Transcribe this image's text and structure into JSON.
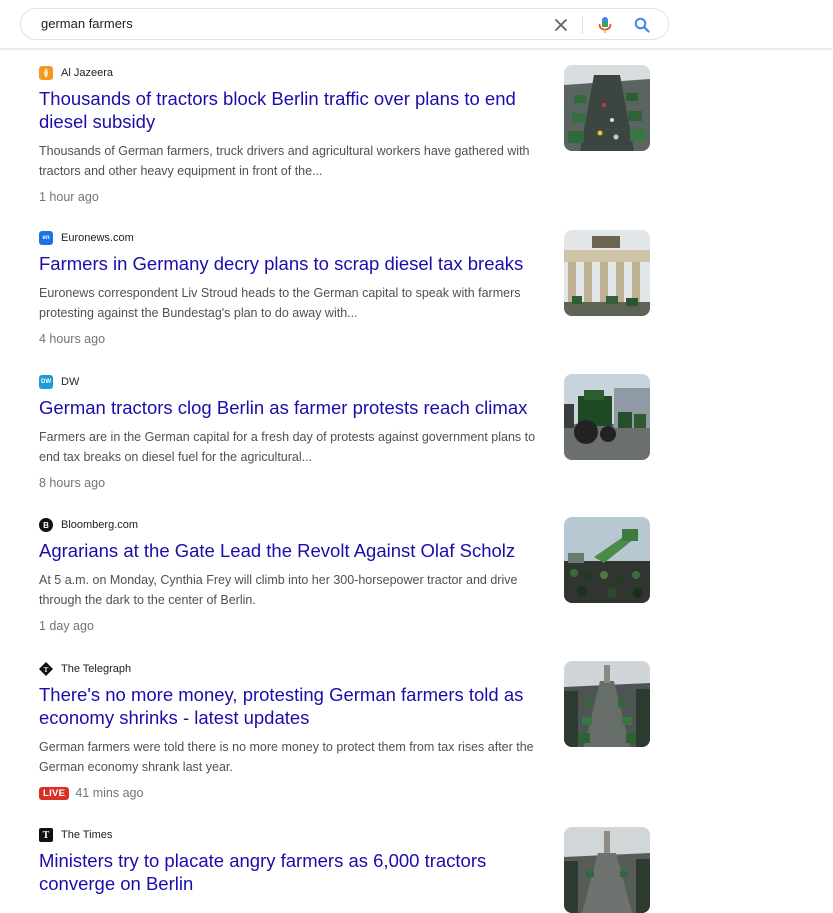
{
  "search": {
    "query": "german farmers"
  },
  "results": [
    {
      "source": "Al Jazeera",
      "favicon": {
        "bg": "#f29a1f",
        "glyph": "◊",
        "color": "#ffffff"
      },
      "title": "Thousands of tractors block Berlin traffic over plans to end diesel subsidy",
      "snippet": "Thousands of German farmers, truck drivers and agricultural workers have gathered with tractors and other heavy equipment in front of the...",
      "time": "1 hour ago",
      "live": false
    },
    {
      "source": "Euronews.com",
      "favicon": {
        "bg": "#1a73e8",
        "glyph": "en",
        "color": "#ffffff"
      },
      "title": "Farmers in Germany decry plans to scrap diesel tax breaks",
      "snippet": "Euronews correspondent Liv Stroud heads to the German capital to speak with farmers protesting against the Bundestag's plan to do away with...",
      "time": "4 hours ago",
      "live": false
    },
    {
      "source": "DW",
      "favicon": {
        "bg": "#1c9bd8",
        "glyph": "DW",
        "color": "#ffffff"
      },
      "title": "German tractors clog Berlin as farmer protests reach climax",
      "snippet": "Farmers are in the German capital for a fresh day of protests against government plans to end tax breaks on diesel fuel for the agricultural...",
      "time": "8 hours ago",
      "live": false
    },
    {
      "source": "Bloomberg.com",
      "favicon": {
        "bg": "#111111",
        "glyph": "B",
        "color": "#ffffff"
      },
      "title": "Agrarians at the Gate Lead the Revolt Against Olaf Scholz",
      "snippet": "At 5 a.m. on Monday, Cynthia Frey will climb into her 300-horsepower tractor and drive through the dark to the center of Berlin.",
      "time": "1 day ago",
      "live": false
    },
    {
      "source": "The Telegraph",
      "favicon": {
        "bg": "#ffffff",
        "glyph": "T",
        "color": "#111111"
      },
      "title": "There's no more money, protesting German farmers told as economy shrinks - latest updates",
      "snippet": "German farmers were told there is no more money to protect them from tax rises after the German economy shrank last year.",
      "time": "41 mins ago",
      "live": true,
      "live_label": "LIVE"
    },
    {
      "source": "The Times",
      "favicon": {
        "bg": "#111111",
        "glyph": "T",
        "color": "#ffffff"
      },
      "title": "Ministers try to placate angry farmers as 6,000 tractors converge on Berlin",
      "snippet": "",
      "time": "",
      "live": false
    }
  ],
  "colors": {
    "link": "#1a0dab",
    "snippet": "#4d5156",
    "meta": "#70757a",
    "live": "#d93025"
  }
}
